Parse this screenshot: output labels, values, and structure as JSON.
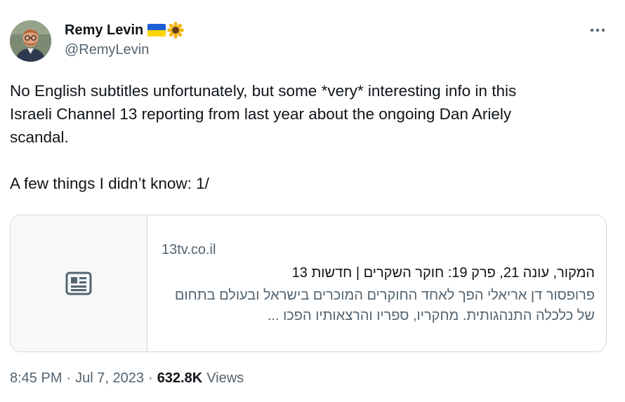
{
  "author": {
    "display_name": "Remy Levin",
    "handle": "@RemyLevin",
    "flag_icon": "ukraine-flag-icon",
    "emoji_icon": "sunflower-icon"
  },
  "more_icon": "more-horizontal-icon",
  "tweet": {
    "text": "No English subtitles unfortunately, but some *very* interesting info in this\nIsraeli Channel 13 reporting from last year about the ongoing Dan Ariely\nscandal.\n\nA few things I didn’t know: 1/"
  },
  "card": {
    "icon": "article-icon",
    "domain": "13tv.co.il",
    "title": "המקור, עונה 21, פרק 19: חוקר השקרים | חדשות 13",
    "description": "פרופסור דן אריאלי הפך לאחד החוקרים המוכרים בישראל ובעולם בתחום של כלכלה התנהגותית. מחקריו, ספריו והרצאותיו הפכו ..."
  },
  "meta": {
    "time": "8:45 PM",
    "separator": "·",
    "date": "Jul 7, 2023",
    "views_count": "632.8K",
    "views_label": "Views"
  },
  "colors": {
    "text_primary": "#0f1419",
    "text_secondary": "#536471",
    "border": "#cfd9de"
  }
}
